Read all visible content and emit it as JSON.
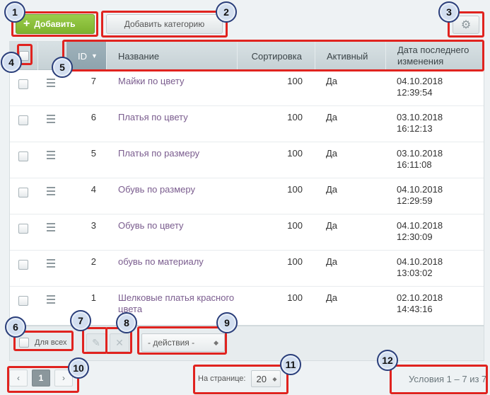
{
  "toolbar": {
    "add_label": "Добавить",
    "add_category_label": "Добавить категорию",
    "settings_icon": "gear-icon"
  },
  "table": {
    "columns": {
      "id": "ID",
      "name": "Название",
      "sort": "Сортировка",
      "active": "Активный",
      "date": "Дата последнего изменения"
    },
    "rows": [
      {
        "id": "7",
        "name": "Майки по цвету",
        "sort": "100",
        "active": "Да",
        "date": "04.10.2018",
        "time": "12:39:54"
      },
      {
        "id": "6",
        "name": "Платья по цвету",
        "sort": "100",
        "active": "Да",
        "date": "03.10.2018",
        "time": "16:12:13"
      },
      {
        "id": "5",
        "name": "Платья по размеру",
        "sort": "100",
        "active": "Да",
        "date": "03.10.2018",
        "time": "16:11:08"
      },
      {
        "id": "4",
        "name": "Обувь по размеру",
        "sort": "100",
        "active": "Да",
        "date": "04.10.2018",
        "time": "12:29:59"
      },
      {
        "id": "3",
        "name": "Обувь по цвету",
        "sort": "100",
        "active": "Да",
        "date": "04.10.2018",
        "time": "12:30:09"
      },
      {
        "id": "2",
        "name": "обувь по материалу",
        "sort": "100",
        "active": "Да",
        "date": "04.10.2018",
        "time": "13:03:02"
      },
      {
        "id": "1",
        "name": "Шелковые платья красного цвета",
        "sort": "100",
        "active": "Да",
        "date": "02.10.2018",
        "time": "14:43:16"
      }
    ]
  },
  "footer": {
    "for_all_label": "Для всех",
    "actions_select": "- действия -",
    "per_page_label": "На странице:",
    "per_page_value": "20",
    "count_label": "Условия 1 – 7 из 7",
    "current_page": "1"
  },
  "annotations": [
    "1",
    "2",
    "3",
    "4",
    "5",
    "6",
    "7",
    "8",
    "9",
    "10",
    "11",
    "12"
  ],
  "colors": {
    "highlight": "#e0231f",
    "badge_fill": "#d3dff0",
    "badge_border": "#2a3e7a",
    "add_button": "#8ac13c"
  }
}
